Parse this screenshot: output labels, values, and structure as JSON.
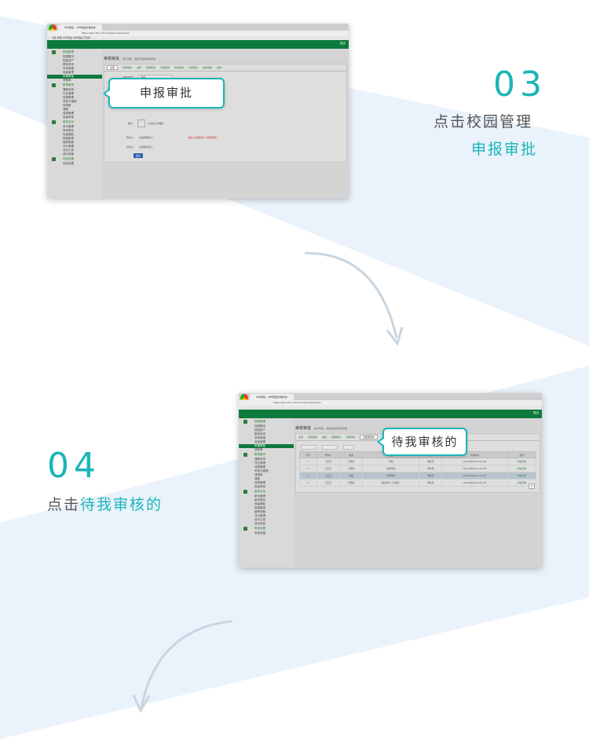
{
  "step3": {
    "number": "03",
    "line1": "点击校园管理",
    "line2": "申报审批",
    "callout": "申报审批",
    "screenshot": {
      "tab_title": "中华颐品 • 中华颐品管理系统",
      "url": "https://bao.36.cn/?s=mobile-index/index",
      "bookmarks": "书签 帮助 中华颐品 中华颐品 开发者",
      "user": "退出",
      "page_title": "审核审批",
      "page_subtitle": "用户申报，发起流程的审核申报",
      "tabs": [
        "全部",
        "我申报的",
        "退回",
        "我审核的",
        "已审核的",
        "待我审核",
        "已结束的",
        "我的申报",
        "其他"
      ],
      "sidebar": [
        {
          "group": "校园管理",
          "items": [
            "校园概况",
            "校园资产",
            "教师风采",
            "学校简报",
            "班级管理",
            "申报审批",
            "请假单"
          ]
        },
        {
          "group": "教育教学",
          "items": [
            "课程安排",
            "作业管理",
            "成绩管理",
            "考勤与管理",
            "成绩册",
            "课程",
            "成绩管理",
            "班级考核"
          ]
        },
        {
          "group": "家校互动",
          "items": [
            "家长管理",
            "家校联系",
            "班级通知",
            "校园新闻",
            "营养配餐",
            "评价管理",
            "成长记录",
            "成长档案"
          ]
        },
        {
          "group": "系统设置",
          "items": [
            "系统设置"
          ]
        }
      ],
      "active_item": "申报审批",
      "form": {
        "type_label": "审批类型：",
        "type_value": "请假",
        "desc_label": "请输入描述",
        "pick_label": "图片：",
        "pick_value": "请点击上传图片",
        "applicant_label": "申请人：",
        "applicant_value": "请选择审批人",
        "applicant_warn": "请输入请假时间（请假天数）",
        "cc_label": "抄送人：",
        "cc_value": "请选择抄送人",
        "submit": "提交"
      }
    }
  },
  "step4": {
    "number": "04",
    "line1_prefix": "点击",
    "line1_highlight": "待我审核的",
    "callout": "待我审核的",
    "screenshot": {
      "tab_title": "中华颐品 • 中华颐品管理系统",
      "url": "https://bao.36.cn/?s=mobile-index/index",
      "user": "退出",
      "page_title": "审核审批",
      "page_subtitle": "用户申报，发起流程的审核申报",
      "tabs": [
        "全部",
        "我申报的",
        "退回",
        "我审核的",
        "已审核的",
        "待我审核的"
      ],
      "table_headers": [
        "序号",
        "申请人",
        "类型",
        "描述",
        "审核人",
        "申请时间",
        "操作"
      ],
      "rows": [
        [
          "1",
          "王五五",
          "已审核",
          "开始",
          "审核员",
          "2019/08/06 10:02:46",
          "查看详情"
        ],
        [
          "2",
          "王五五",
          "已审核",
          "请假申请",
          "审核员",
          "2019/08/06 10:02:46",
          "查看详情"
        ],
        [
          "3",
          "王五五",
          "请假",
          "请假申请",
          "审核员",
          "2019/08/06 11:02:47",
          "查看详情"
        ],
        [
          "4",
          "王五五",
          "已审核",
          "请假申请（已完成）",
          "审核员",
          "2019/08/06 10:02:46",
          "查看详情"
        ]
      ],
      "selected_row": 2,
      "sidebar": [
        {
          "group": "校园管理",
          "items": [
            "校园概况",
            "校园资产",
            "教师风采",
            "学校简报",
            "班级管理",
            "申报审批",
            "请假单"
          ]
        },
        {
          "group": "教育教学",
          "items": [
            "课程安排",
            "作业管理",
            "成绩管理",
            "考勤与管理",
            "成绩册",
            "课程",
            "成绩管理",
            "班级考核"
          ]
        },
        {
          "group": "家校互动",
          "items": [
            "家长管理",
            "家校联系",
            "班级通知",
            "校园新闻",
            "营养配餐",
            "评价管理",
            "成长记录",
            "成长档案"
          ]
        },
        {
          "group": "系统设置",
          "items": [
            "系统设置"
          ]
        }
      ],
      "active_item": "申报审批",
      "pagination": "1"
    }
  },
  "colors": {
    "accent": "#1ab5b8",
    "green_header": "#0e7a3d",
    "stripe": "#e8f1fb"
  }
}
